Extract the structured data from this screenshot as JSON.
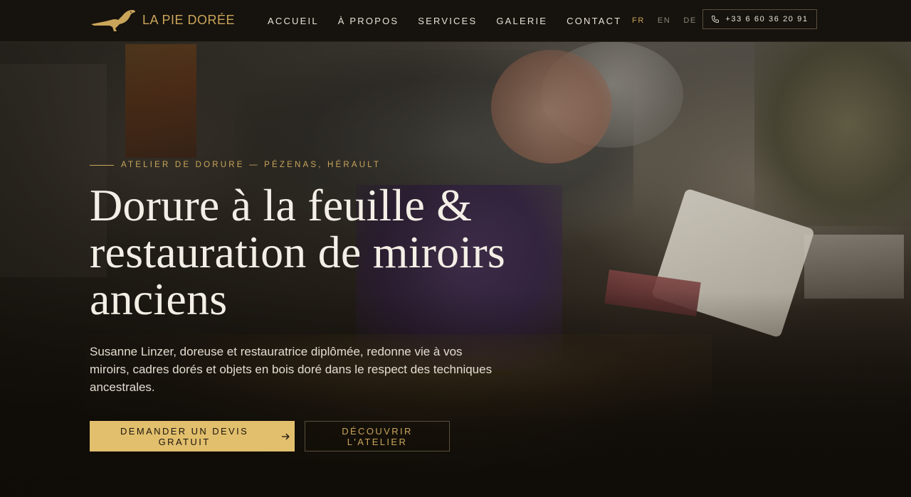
{
  "brand": {
    "name": "LA PIE DORÉE",
    "logo_icon": "magpie-bird-icon",
    "accent_color": "#c9a55a"
  },
  "nav": {
    "items": [
      {
        "label": "ACCUEIL"
      },
      {
        "label": "À PROPOS"
      },
      {
        "label": "SERVICES"
      },
      {
        "label": "GALERIE"
      },
      {
        "label": "CONTACT"
      }
    ]
  },
  "languages": {
    "items": [
      {
        "code": "FR",
        "active": true
      },
      {
        "code": "EN",
        "active": false
      },
      {
        "code": "DE",
        "active": false
      }
    ]
  },
  "header": {
    "phone_icon": "phone-icon",
    "phone": "+33 6 60 36 20 91"
  },
  "hero": {
    "eyebrow": "ATELIER DE DORURE — PÉZENAS, HÉRAULT",
    "headline_line1": "Dorure à la feuille &",
    "headline_line2": "restauration de miroirs anciens",
    "lead": "Susanne Linzer, doreuse et restauratrice diplômée, redonne vie à vos miroirs, cadres dorés et objets en bois doré dans le respect des techniques ancestrales.",
    "cta_primary": "DEMANDER UN DEVIS GRATUIT",
    "cta_primary_icon": "arrow-right-icon",
    "cta_secondary": "DÉCOUVRIR L'ATELIER"
  },
  "colors": {
    "header_bg": "#16120d",
    "gold_button": "#e2bf6d",
    "text_light": "#f4efe6"
  }
}
